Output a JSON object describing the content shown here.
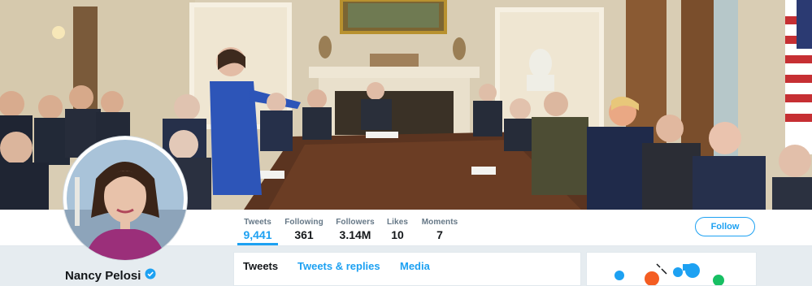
{
  "profile": {
    "name": "Nancy Pelosi",
    "verified": true,
    "follow_label": "Follow"
  },
  "stats": [
    {
      "label": "Tweets",
      "value": "9,441",
      "active": true
    },
    {
      "label": "Following",
      "value": "361"
    },
    {
      "label": "Followers",
      "value": "3.14M"
    },
    {
      "label": "Likes",
      "value": "10"
    },
    {
      "label": "Moments",
      "value": "7"
    }
  ],
  "tabs": [
    {
      "label": "Tweets",
      "active": true
    },
    {
      "label": "Tweets & replies"
    },
    {
      "label": "Media"
    }
  ],
  "colors": {
    "accent": "#1da1f2",
    "page_bg": "#e6ecf0",
    "text_primary": "#14171a",
    "text_secondary": "#657786"
  },
  "icons": {
    "verified": "verified-badge-icon"
  }
}
